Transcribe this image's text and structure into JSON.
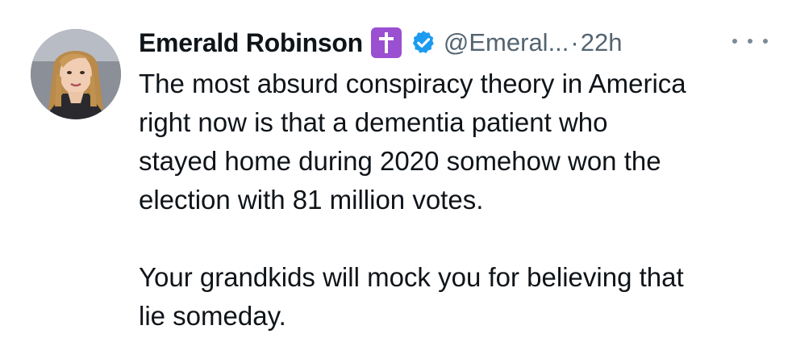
{
  "tweet": {
    "author": {
      "display_name": "Emerald Robinson",
      "badge_icon": "latin-cross-icon",
      "badge_color": "#9b4fd1",
      "verified_icon": "verified-badge-icon",
      "verified_color": "#1d9bf0",
      "handle": "@Emeral...",
      "separator": "·",
      "time": "22h"
    },
    "more_icon": "more-horizontal-icon",
    "paragraphs": [
      "The most absurd conspiracy theory in America\nright now is that a dementia patient who\nstayed home during 2020 somehow won the\nelection with 81 million votes.",
      "Your grandkids will mock you for believing that\nlie someday."
    ]
  }
}
